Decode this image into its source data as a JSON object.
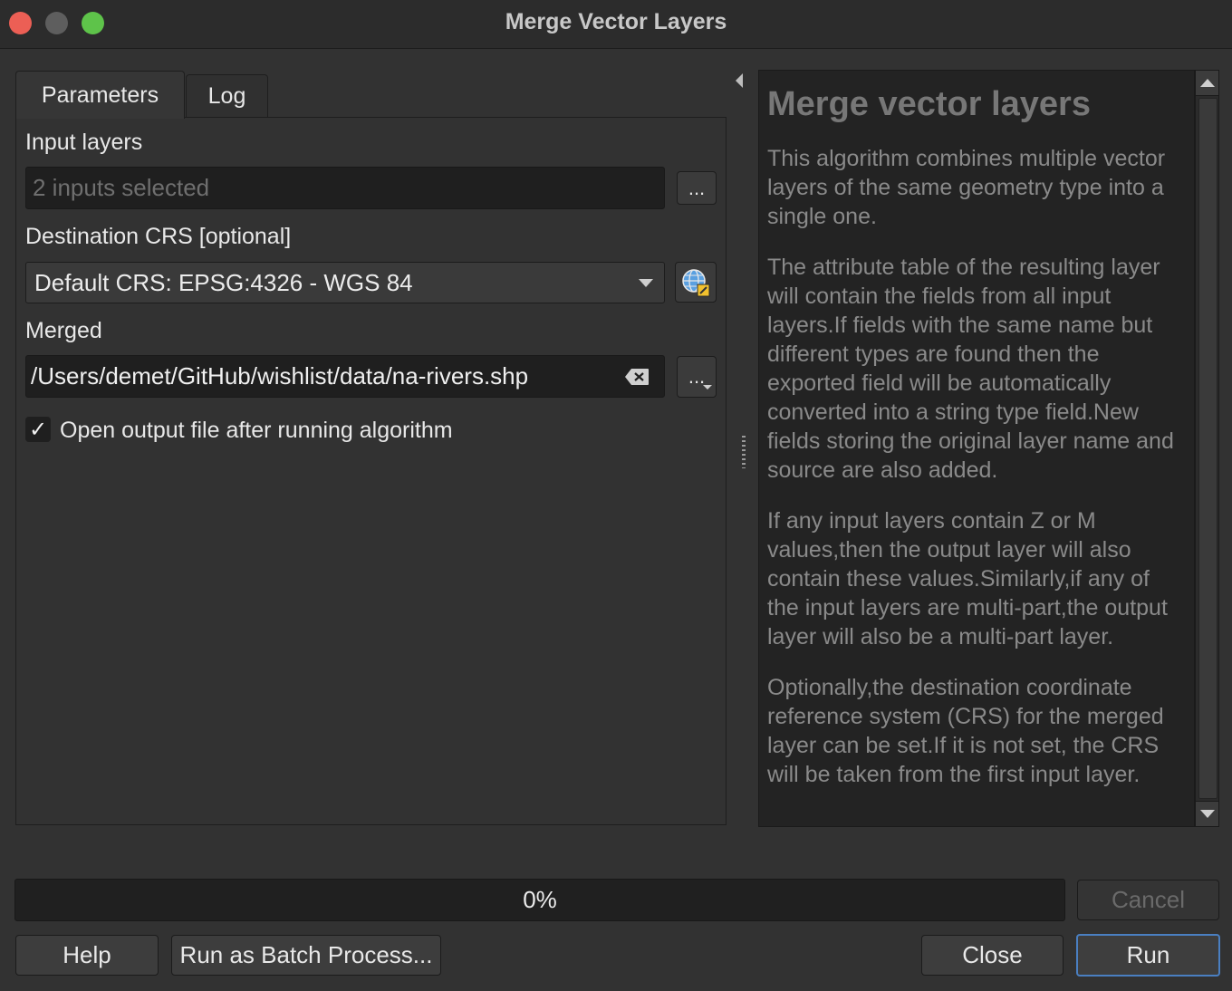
{
  "window": {
    "title": "Merge Vector Layers"
  },
  "tabs": [
    {
      "label": "Parameters"
    },
    {
      "label": "Log"
    }
  ],
  "params": {
    "input_layers": {
      "label": "Input layers",
      "value": "2 inputs selected",
      "button": "..."
    },
    "crs": {
      "label": "Destination CRS [optional]",
      "value": "Default CRS: EPSG:4326 - WGS 84"
    },
    "merged": {
      "label": "Merged",
      "value": "/Users/demet/GitHub/wishlist/data/na-rivers.shp",
      "button": "..."
    },
    "open_output": {
      "label": "Open output file after running algorithm",
      "checked": true,
      "check_glyph": "✓"
    }
  },
  "help": {
    "title": "Merge vector layers",
    "paragraphs": [
      "This algorithm combines multiple vector layers of the same geometry type into a single one.",
      "The attribute table of the resulting layer will contain the fields from all input layers.If fields with the same name but different types are found then the exported field will be automatically converted into a string type field.New fields storing the original layer name and source are also added.",
      "If any input layers contain Z or M values,then the output layer will also contain these values.Similarly,if any of the input layers are multi-part,the output layer will also be a multi-part layer.",
      "Optionally,the destination coordinate reference system (CRS) for the merged layer can be set.If it is not set, the CRS will be taken from the first input layer."
    ]
  },
  "progress": {
    "value": 0,
    "text": "0%"
  },
  "buttons": {
    "cancel": "Cancel",
    "help": "Help",
    "batch": "Run as Batch Process...",
    "close": "Close",
    "run": "Run"
  },
  "colors": {
    "accent": "#4a7fc1",
    "close": "#ec5f55",
    "minimize": "#5e5e5e",
    "maximize": "#5ec34a"
  }
}
